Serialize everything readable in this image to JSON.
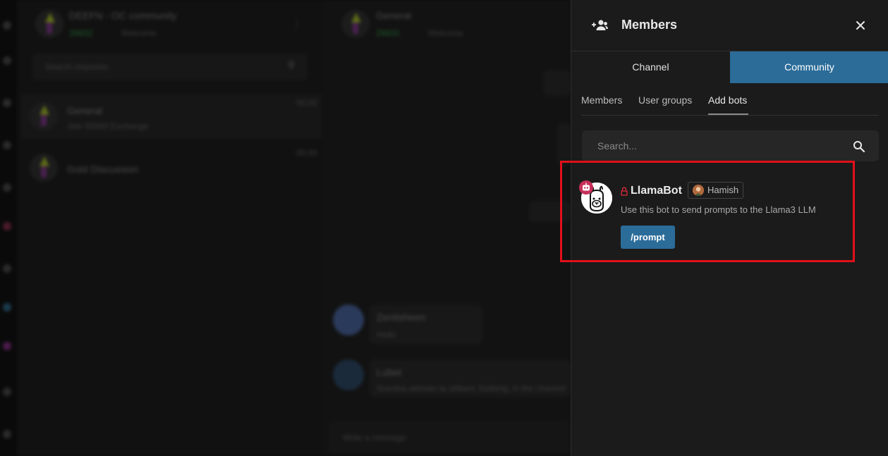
{
  "background": {
    "community_name": "DEEFN - OC community",
    "community_online": "29832",
    "community_sub": "Welcome",
    "channel_search_placeholder": "Search channels",
    "channels": [
      {
        "name": "General",
        "preview": "Join 50000 Exchange",
        "time": "00:00"
      },
      {
        "name": "Gold Discussion",
        "preview": "",
        "time": "00:00"
      }
    ],
    "chat_title": "General",
    "chat_online": "29832",
    "chat_sub": "Welcome",
    "messages": [
      {
        "author": "Zenitsheen",
        "text": "Hello"
      },
      {
        "author": "Lubet",
        "text": "Nuestra attendo la utilitare Stalking, in the channel"
      }
    ],
    "message_placeholder": "Write a message"
  },
  "panel": {
    "title": "Members",
    "segments": [
      "Channel",
      "Community"
    ],
    "active_segment": "Community",
    "subtabs": [
      "Members",
      "User groups",
      "Add bots"
    ],
    "active_subtab": "Add bots",
    "search_placeholder": "Search...",
    "bots": [
      {
        "name": "LlamaBot",
        "owner": "Hamish",
        "description": "Use this bot to send prompts to the Llama3 LLM",
        "commands": [
          "/prompt"
        ]
      }
    ]
  },
  "colors": {
    "accent": "#2b6c99",
    "highlight": "#e1101a",
    "panel_bg": "#1b1b1b",
    "bot_badge": "#c7305a"
  },
  "icons": {
    "header": "add-members-icon",
    "close": "close-icon",
    "search": "search-icon",
    "lock": "lock-icon",
    "bot_badge": "bot-icon"
  }
}
